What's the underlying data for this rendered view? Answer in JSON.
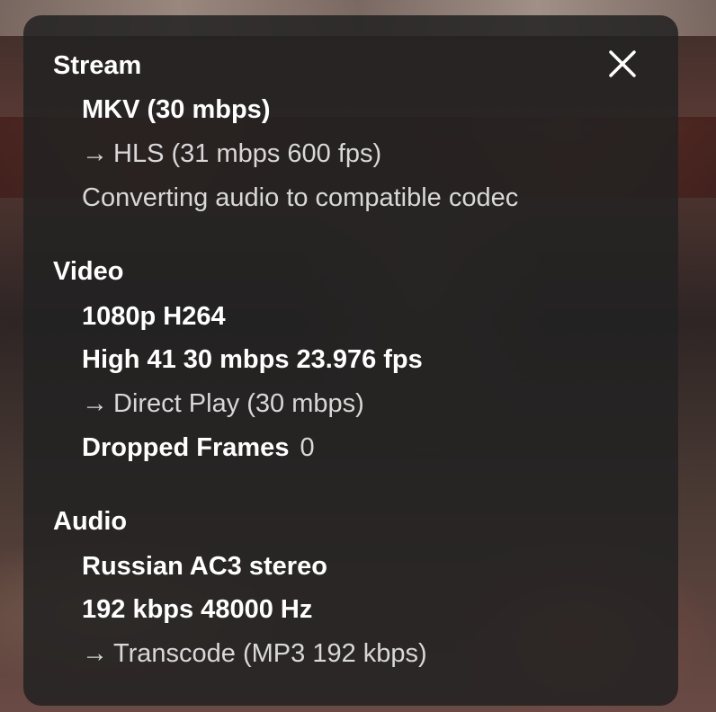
{
  "close_icon": "close-x-icon",
  "stream": {
    "title": "Stream",
    "container": "MKV (30 mbps)",
    "arrow": "→",
    "target": "HLS (31 mbps 600 fps)",
    "note": "Converting audio to compatible codec"
  },
  "video": {
    "title": "Video",
    "resolution_codec": "1080p H264",
    "profile": "High 41 30 mbps 23.976 fps",
    "arrow": "→",
    "decision": "Direct Play (30 mbps)",
    "dropped_label": "Dropped Frames",
    "dropped_value": "0"
  },
  "audio": {
    "title": "Audio",
    "track": "Russian AC3 stereo",
    "details": "192 kbps 48000 Hz",
    "arrow": "→",
    "decision": "Transcode (MP3 192 kbps)"
  }
}
